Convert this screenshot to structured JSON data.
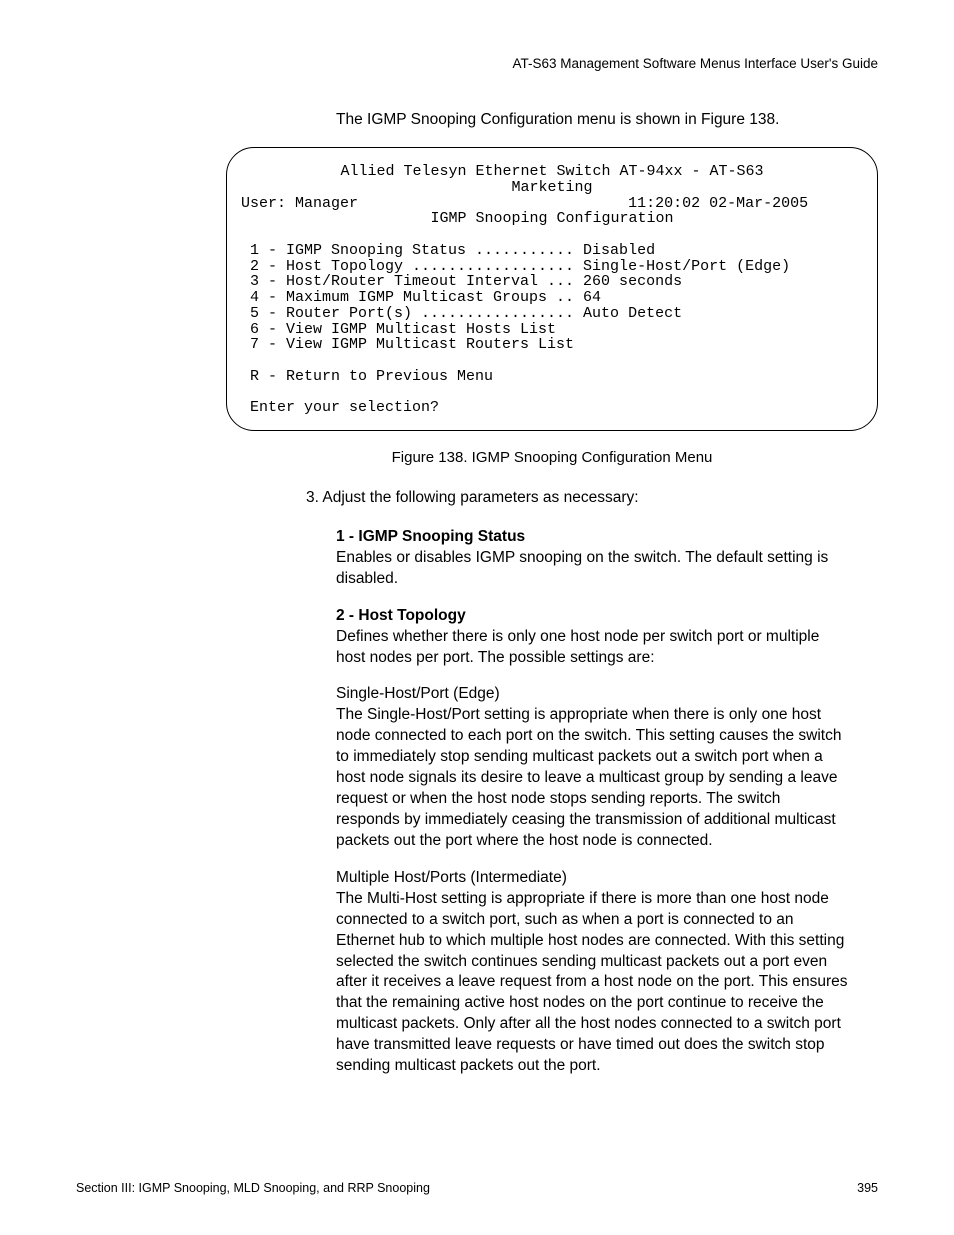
{
  "header": "AT-S63 Management Software Menus Interface User's Guide",
  "intro": "The IGMP Snooping Configuration menu is shown in Figure 138.",
  "terminal": {
    "title1": "Allied Telesyn Ethernet Switch AT-94xx - AT-S63",
    "title2": "Marketing",
    "user": "User: Manager",
    "timestamp": "11:20:02 02-Mar-2005",
    "menutitle": "IGMP Snooping Configuration",
    "items": [
      " 1 - IGMP Snooping Status ........... Disabled",
      " 2 - Host Topology .................. Single-Host/Port (Edge)",
      " 3 - Host/Router Timeout Interval ... 260 seconds",
      " 4 - Maximum IGMP Multicast Groups .. 64",
      " 5 - Router Port(s) ................. Auto Detect",
      " 6 - View IGMP Multicast Hosts List",
      " 7 - View IGMP Multicast Routers List"
    ],
    "return": " R - Return to Previous Menu",
    "prompt": " Enter your selection?"
  },
  "caption": "Figure 138. IGMP Snooping Configuration Menu",
  "step3": "3. Adjust the following parameters as necessary:",
  "opt1_h": "1 - IGMP Snooping Status",
  "opt1_b": "Enables or disables IGMP snooping on the switch. The default setting is disabled.",
  "opt2_h": "2 - Host Topology",
  "opt2_b": "Defines whether there is only one host node per switch port or multiple host nodes per port. The possible settings are:",
  "sh_h": "Single-Host/Port (Edge)",
  "sh_b": "The Single-Host/Port setting is appropriate when there is only one host node connected to each port on the switch. This setting causes the switch to immediately stop sending multicast packets out a switch port when a host node signals its desire to leave a multicast group by sending a leave request or when the host node stops sending reports. The switch responds by immediately ceasing the transmission of additional multicast packets out the port where the host node is connected.",
  "mh_h": "Multiple Host/Ports (Intermediate)",
  "mh_b": "The Multi-Host setting is appropriate if there is more than one host node connected to a switch port, such as when a port is connected to an Ethernet hub to which multiple host nodes are connected. With this setting selected the switch continues sending multicast packets out a port even after it receives a leave request from a host node on the port. This ensures that the remaining active host nodes on the port continue to receive the multicast packets. Only after all the host nodes connected to a switch port have transmitted leave requests or have timed out does the switch stop sending multicast packets out the port.",
  "footer_left": "Section III: IGMP Snooping, MLD Snooping, and RRP Snooping",
  "footer_right": "395"
}
